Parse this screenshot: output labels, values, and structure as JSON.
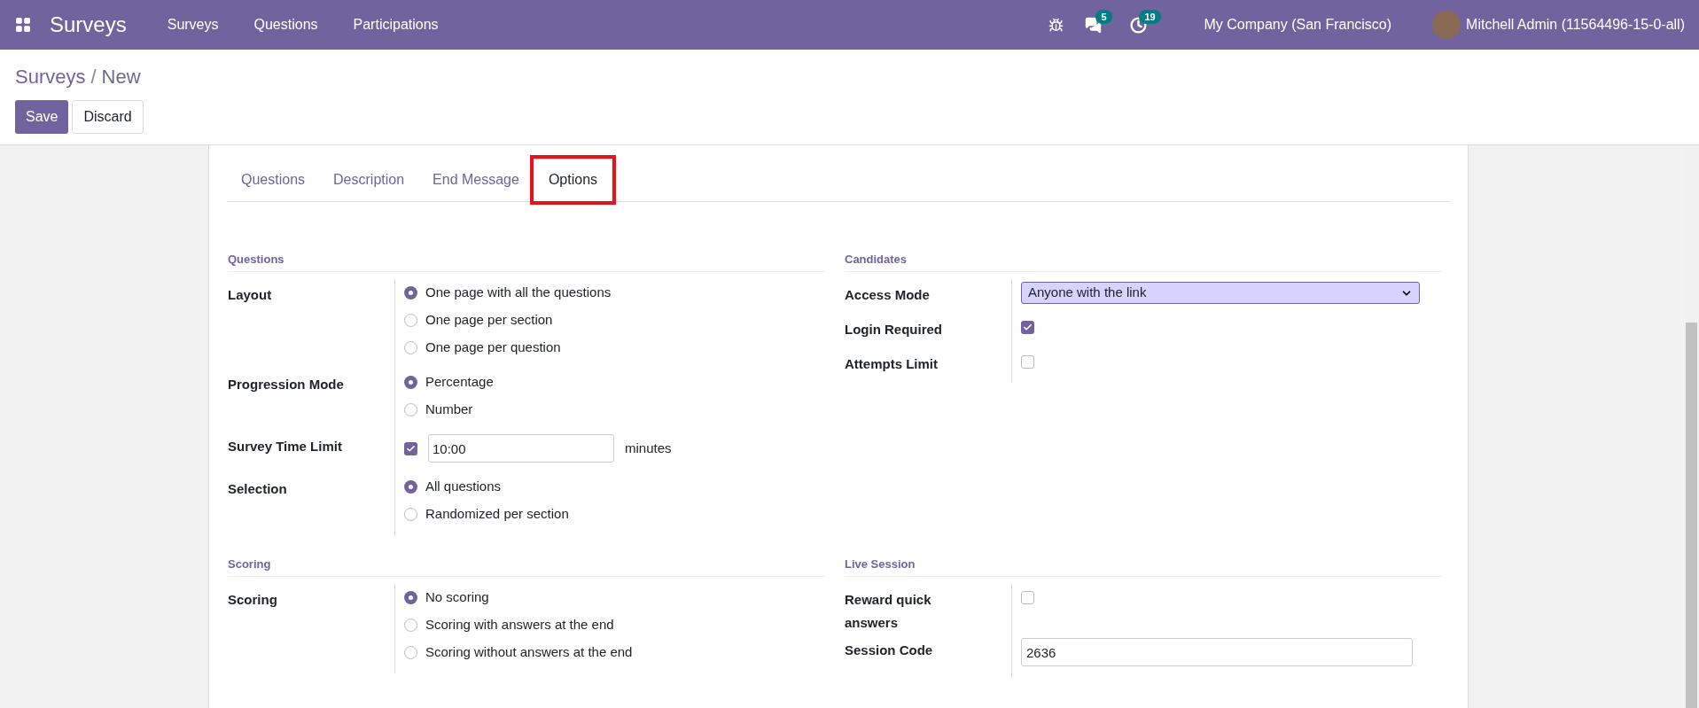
{
  "navbar": {
    "app_title": "Surveys",
    "menu": [
      "Surveys",
      "Questions",
      "Participations"
    ],
    "messages_badge": "5",
    "activities_badge": "19",
    "company": "My Company (San Francisco)",
    "user": "Mitchell Admin (11564496-15-0-all)"
  },
  "breadcrumb": {
    "parent": "Surveys",
    "separator": "/",
    "current": "New"
  },
  "buttons": [
    {
      "label": "Save",
      "kind": "primary"
    },
    {
      "label": "Discard",
      "kind": "secondary"
    }
  ],
  "tabs": [
    {
      "label": "Questions",
      "selected": false,
      "highlighted": false
    },
    {
      "label": "Description",
      "selected": false,
      "highlighted": false
    },
    {
      "label": "End Message",
      "selected": false,
      "highlighted": false
    },
    {
      "label": "Options",
      "selected": true,
      "highlighted": true
    }
  ],
  "groups": [
    {
      "title": "Questions",
      "fields": [
        {
          "label": "Layout",
          "kind": "radio",
          "options": [
            {
              "label": "One page with all the questions",
              "selected": true
            },
            {
              "label": "One page per section",
              "selected": false
            },
            {
              "label": "One page per question",
              "selected": false
            }
          ]
        },
        {
          "label": "Progression Mode",
          "kind": "radio",
          "options": [
            {
              "label": "Percentage",
              "selected": true
            },
            {
              "label": "Number",
              "selected": false
            }
          ]
        },
        {
          "label": "Survey Time Limit",
          "kind": "checkbox_input",
          "checked": true,
          "value": "10:00",
          "unit": "minutes"
        },
        {
          "label": "Selection",
          "kind": "radio",
          "options": [
            {
              "label": "All questions",
              "selected": true
            },
            {
              "label": "Randomized per section",
              "selected": false
            }
          ]
        }
      ]
    },
    {
      "title": "Candidates",
      "fields": [
        {
          "label": "Access Mode",
          "kind": "select",
          "value": "Anyone with the link"
        },
        {
          "label": "Login Required",
          "kind": "checkbox",
          "checked": true
        },
        {
          "label": "Attempts Limit",
          "kind": "checkbox",
          "checked": false
        }
      ]
    },
    {
      "title": "Scoring",
      "fields": [
        {
          "label": "Scoring",
          "kind": "radio",
          "options": [
            {
              "label": "No scoring",
              "selected": true
            },
            {
              "label": "Scoring with answers at the end",
              "selected": false
            },
            {
              "label": "Scoring without answers at the end",
              "selected": false
            }
          ]
        }
      ]
    },
    {
      "title": "Live Session",
      "fields": [
        {
          "label": "Reward quick answers",
          "kind": "checkbox",
          "checked": false
        },
        {
          "label": "Session Code",
          "kind": "text",
          "value": "2636"
        }
      ]
    }
  ]
}
